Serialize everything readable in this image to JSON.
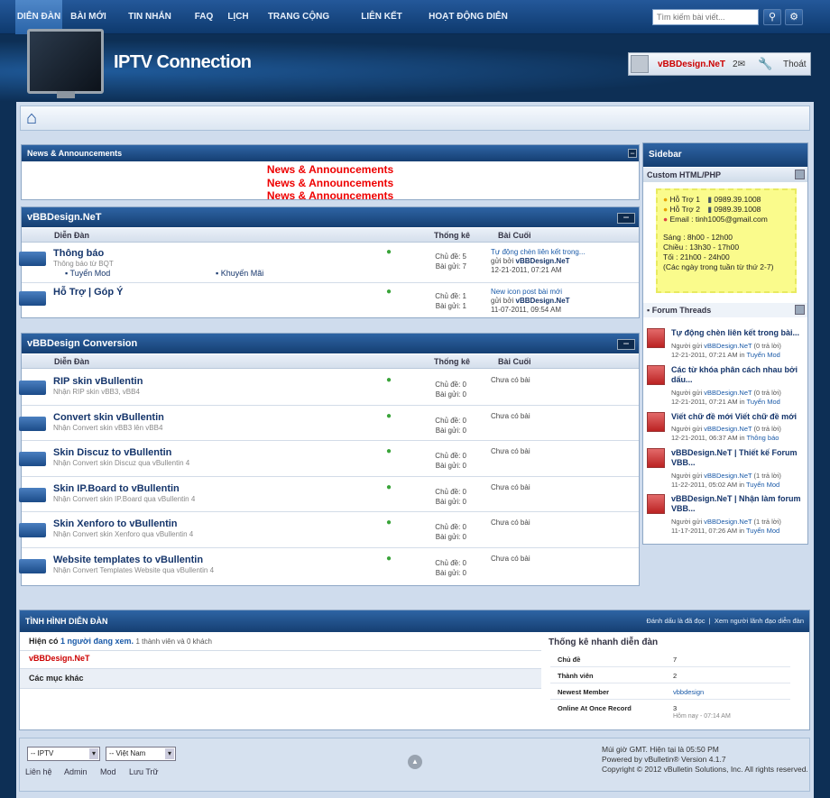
{
  "nav": {
    "items": [
      "DIỄN ĐÀN",
      "BÀI MỚI",
      "TIN NHẮN RIÊNG",
      "FAQ",
      "LỊCH",
      "TRANG CỘNG ĐỒNG",
      "LIÊN KẾT NHANH",
      "HOẠT ĐỘNG DIỄN ĐÀN"
    ],
    "search_placeholder": "Tìm kiếm bài viết...",
    "search_icon": "search-icon",
    "settings_icon": "gear-icon"
  },
  "header": {
    "site_title": "IPTV Connection",
    "username": "vBBDesign.NeT",
    "message_count": "2",
    "logout": "Thoát"
  },
  "news": {
    "header": "News & Announcements",
    "lines": [
      "News & Announcements",
      "News & Announcements",
      "News & Announcements"
    ]
  },
  "cat1": {
    "title": "vBBDesign.NeT",
    "col_forum": "Diễn Đàn",
    "col_stats": "Thống kê",
    "col_last": "Bài Cuối",
    "forums": [
      {
        "title": "Thông báo",
        "desc": "Thông báo từ BQT",
        "sub1": "Tuyển Mod",
        "sub2": "Khuyến Mãi",
        "threads": "Chủ đề: 5",
        "posts": "Bài gửi: 7",
        "last_title": "Tự động chèn liên kết trong...",
        "last_by": "gửi bởi",
        "last_user": "vBBDesign.NeT",
        "last_date": "12-21-2011,",
        "last_time": "07:21 AM"
      },
      {
        "title": "Hỗ Trợ | Góp Ý",
        "desc": "",
        "threads": "Chủ đề: 1",
        "posts": "Bài gửi: 1",
        "last_title": "New icon post bài mới",
        "last_by": "gửi bởi",
        "last_user": "vBBDesign.NeT",
        "last_date": "11-07-2011,",
        "last_time": "09:54 AM"
      }
    ]
  },
  "cat2": {
    "title": "vBBDesign Conversion",
    "col_forum": "Diễn Đàn",
    "col_stats": "Thống kê",
    "col_last": "Bài Cuối",
    "forums": [
      {
        "title": "RIP skin vBullentin",
        "desc": "Nhận RIP skin vBB3, vBB4",
        "threads": "Chủ đề: 0",
        "posts": "Bài gửi: 0",
        "last": "Chưa có bài"
      },
      {
        "title": "Convert skin vBullentin",
        "desc": "Nhận Convert skin vBB3 lên vBB4",
        "threads": "Chủ đề: 0",
        "posts": "Bài gửi: 0",
        "last": "Chưa có bài"
      },
      {
        "title": "Skin Discuz to vBullentin",
        "desc": "Nhận Convert skin Discuz qua vBullentin 4",
        "threads": "Chủ đề: 0",
        "posts": "Bài gửi: 0",
        "last": "Chưa có bài"
      },
      {
        "title": "Skin IP.Board to vBullentin",
        "desc": "Nhận Convert skin IP.Board qua vBullentin 4",
        "threads": "Chủ đề: 0",
        "posts": "Bài gửi: 0",
        "last": "Chưa có bài"
      },
      {
        "title": "Skin Xenforo to vBullentin",
        "desc": "Nhận Convert skin Xenforo qua vBullentin 4",
        "threads": "Chủ đề: 0",
        "posts": "Bài gửi: 0",
        "last": "Chưa có bài"
      },
      {
        "title": "Website templates to vBullentin",
        "desc": "Nhận Convert Templates Website qua vBullentin 4",
        "threads": "Chủ đề: 0",
        "posts": "Bài gửi: 0",
        "last": "Chưa có bài"
      }
    ]
  },
  "sidebar": {
    "title": "Sidebar",
    "custom_title": "Custom HTML/PHP",
    "support": {
      "line1": "Hỗ Trợ 1",
      "phone1": "0989.39.1008",
      "line2": "Hỗ Trợ 2",
      "phone2": "0989.39.1008",
      "email": "Email : tinh1005@gmail.com",
      "h1": "Sáng : 8h00 - 12h00",
      "h2": "Chiều : 13h30 - 17h00",
      "h3": "Tối : 21h00 - 24h00",
      "h4": "(Các ngày trong tuần từ thứ 2-7)"
    },
    "threads_title": "Forum Threads",
    "threads": [
      {
        "title": "Tự động chèn liên kết trong bài...",
        "by": "Người gửi",
        "user": "vBBDesign.NeT",
        "replies": "(0 trả lời)",
        "date": "12-21-2011, 07:21 AM in",
        "forum": "Tuyển Mod"
      },
      {
        "title": "Các từ khóa phân cách nhau bởi dấu...",
        "by": "Người gửi",
        "user": "vBBDesign.NeT",
        "replies": "(0 trả lời)",
        "date": "12-21-2011, 07:21 AM in",
        "forum": "Tuyển Mod"
      },
      {
        "title": "Viết chữ đề mới Viết chữ đề mới",
        "by": "Người gửi",
        "user": "vBBDesign.NeT",
        "replies": "(0 trả lời)",
        "date": "12-21-2011, 06:37 AM in",
        "forum": "Thông báo"
      },
      {
        "title": "vBBDesign.NeT | Thiết kế Forum VBB...",
        "by": "Người gửi",
        "user": "vBBDesign.NeT",
        "replies": "(1 trả lời)",
        "date": "11-22-2011, 05:02 AM in",
        "forum": "Tuyển Mod"
      },
      {
        "title": "vBBDesign.NeT | Nhận làm forum VBB...",
        "by": "Người gửi",
        "user": "vBBDesign.NeT",
        "replies": "(1 trả lời)",
        "date": "11-17-2011, 07:26 AM in",
        "forum": "Tuyển Mod"
      }
    ]
  },
  "whats": {
    "title": "TÌNH HÌNH DIỄN ĐÀN",
    "mark_read": "Đánh dấu là đã đọc",
    "view_leaders": "Xem người lãnh đạo diễn đàn",
    "online_prefix": "Hiện có",
    "online_count": "1 người đang xem.",
    "online_detail": "1 thành viên và 0 khách",
    "online_user": "vBBDesign.NeT",
    "misc": "Các mục khác",
    "stats_title": "Thống kê nhanh diễn đàn",
    "stats": [
      {
        "k": "Chủ đề",
        "v": "7"
      },
      {
        "k": "Thành viên",
        "v": "2"
      },
      {
        "k": "Newest Member",
        "v": "vbbdesign"
      },
      {
        "k": "Online At Once Record",
        "v": "3"
      }
    ],
    "record_sub": "Hôm nay - 07:14 AM"
  },
  "footer": {
    "style_select": "-- IPTV",
    "lang_select": "-- Việt Nam",
    "links": [
      "Liên hệ",
      "Admin",
      "Mod",
      "Lưu Trữ"
    ],
    "time": "Múi giờ GMT. Hiện tại là 05:50 PM",
    "powered": "Powered by vBulletin® Version 4.1.7",
    "copyright": "Copyright © 2012 vBulletin Solutions, Inc. All rights reserved."
  }
}
